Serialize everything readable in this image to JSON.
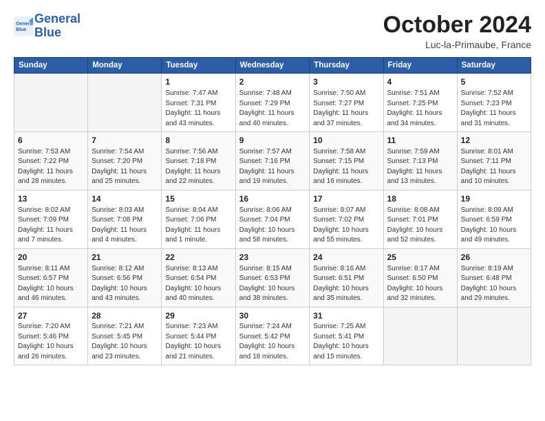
{
  "header": {
    "logo_line1": "General",
    "logo_line2": "Blue",
    "month_title": "October 2024",
    "location": "Luc-la-Primaube, France"
  },
  "weekdays": [
    "Sunday",
    "Monday",
    "Tuesday",
    "Wednesday",
    "Thursday",
    "Friday",
    "Saturday"
  ],
  "weeks": [
    [
      {
        "day": "",
        "info": ""
      },
      {
        "day": "",
        "info": ""
      },
      {
        "day": "1",
        "info": "Sunrise: 7:47 AM\nSunset: 7:31 PM\nDaylight: 11 hours and 43 minutes."
      },
      {
        "day": "2",
        "info": "Sunrise: 7:48 AM\nSunset: 7:29 PM\nDaylight: 11 hours and 40 minutes."
      },
      {
        "day": "3",
        "info": "Sunrise: 7:50 AM\nSunset: 7:27 PM\nDaylight: 11 hours and 37 minutes."
      },
      {
        "day": "4",
        "info": "Sunrise: 7:51 AM\nSunset: 7:25 PM\nDaylight: 11 hours and 34 minutes."
      },
      {
        "day": "5",
        "info": "Sunrise: 7:52 AM\nSunset: 7:23 PM\nDaylight: 11 hours and 31 minutes."
      }
    ],
    [
      {
        "day": "6",
        "info": "Sunrise: 7:53 AM\nSunset: 7:22 PM\nDaylight: 11 hours and 28 minutes."
      },
      {
        "day": "7",
        "info": "Sunrise: 7:54 AM\nSunset: 7:20 PM\nDaylight: 11 hours and 25 minutes."
      },
      {
        "day": "8",
        "info": "Sunrise: 7:56 AM\nSunset: 7:18 PM\nDaylight: 11 hours and 22 minutes."
      },
      {
        "day": "9",
        "info": "Sunrise: 7:57 AM\nSunset: 7:16 PM\nDaylight: 11 hours and 19 minutes."
      },
      {
        "day": "10",
        "info": "Sunrise: 7:58 AM\nSunset: 7:15 PM\nDaylight: 11 hours and 16 minutes."
      },
      {
        "day": "11",
        "info": "Sunrise: 7:59 AM\nSunset: 7:13 PM\nDaylight: 11 hours and 13 minutes."
      },
      {
        "day": "12",
        "info": "Sunrise: 8:01 AM\nSunset: 7:11 PM\nDaylight: 11 hours and 10 minutes."
      }
    ],
    [
      {
        "day": "13",
        "info": "Sunrise: 8:02 AM\nSunset: 7:09 PM\nDaylight: 11 hours and 7 minutes."
      },
      {
        "day": "14",
        "info": "Sunrise: 8:03 AM\nSunset: 7:08 PM\nDaylight: 11 hours and 4 minutes."
      },
      {
        "day": "15",
        "info": "Sunrise: 8:04 AM\nSunset: 7:06 PM\nDaylight: 11 hours and 1 minute."
      },
      {
        "day": "16",
        "info": "Sunrise: 8:06 AM\nSunset: 7:04 PM\nDaylight: 10 hours and 58 minutes."
      },
      {
        "day": "17",
        "info": "Sunrise: 8:07 AM\nSunset: 7:02 PM\nDaylight: 10 hours and 55 minutes."
      },
      {
        "day": "18",
        "info": "Sunrise: 8:08 AM\nSunset: 7:01 PM\nDaylight: 10 hours and 52 minutes."
      },
      {
        "day": "19",
        "info": "Sunrise: 8:09 AM\nSunset: 6:59 PM\nDaylight: 10 hours and 49 minutes."
      }
    ],
    [
      {
        "day": "20",
        "info": "Sunrise: 8:11 AM\nSunset: 6:57 PM\nDaylight: 10 hours and 46 minutes."
      },
      {
        "day": "21",
        "info": "Sunrise: 8:12 AM\nSunset: 6:56 PM\nDaylight: 10 hours and 43 minutes."
      },
      {
        "day": "22",
        "info": "Sunrise: 8:13 AM\nSunset: 6:54 PM\nDaylight: 10 hours and 40 minutes."
      },
      {
        "day": "23",
        "info": "Sunrise: 8:15 AM\nSunset: 6:53 PM\nDaylight: 10 hours and 38 minutes."
      },
      {
        "day": "24",
        "info": "Sunrise: 8:16 AM\nSunset: 6:51 PM\nDaylight: 10 hours and 35 minutes."
      },
      {
        "day": "25",
        "info": "Sunrise: 8:17 AM\nSunset: 6:50 PM\nDaylight: 10 hours and 32 minutes."
      },
      {
        "day": "26",
        "info": "Sunrise: 8:19 AM\nSunset: 6:48 PM\nDaylight: 10 hours and 29 minutes."
      }
    ],
    [
      {
        "day": "27",
        "info": "Sunrise: 7:20 AM\nSunset: 5:46 PM\nDaylight: 10 hours and 26 minutes."
      },
      {
        "day": "28",
        "info": "Sunrise: 7:21 AM\nSunset: 5:45 PM\nDaylight: 10 hours and 23 minutes."
      },
      {
        "day": "29",
        "info": "Sunrise: 7:23 AM\nSunset: 5:44 PM\nDaylight: 10 hours and 21 minutes."
      },
      {
        "day": "30",
        "info": "Sunrise: 7:24 AM\nSunset: 5:42 PM\nDaylight: 10 hours and 18 minutes."
      },
      {
        "day": "31",
        "info": "Sunrise: 7:25 AM\nSunset: 5:41 PM\nDaylight: 10 hours and 15 minutes."
      },
      {
        "day": "",
        "info": ""
      },
      {
        "day": "",
        "info": ""
      }
    ]
  ]
}
